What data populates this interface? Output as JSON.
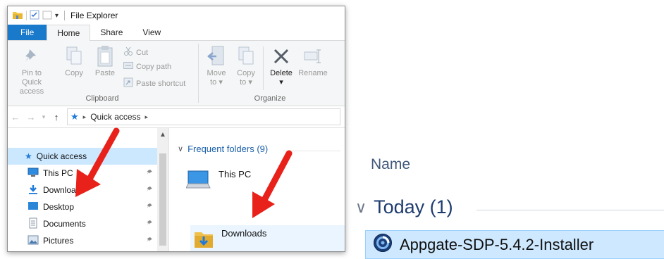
{
  "window": {
    "title": "File Explorer",
    "tabs": [
      {
        "label": "File"
      },
      {
        "label": "Home"
      },
      {
        "label": "Share"
      },
      {
        "label": "View"
      }
    ]
  },
  "ribbon": {
    "clipboard": {
      "pin_line1": "Pin to Quick",
      "pin_line2": "access",
      "copy": "Copy",
      "paste": "Paste",
      "cut": "Cut",
      "copy_path": "Copy path",
      "paste_shortcut": "Paste shortcut",
      "group_label": "Clipboard"
    },
    "organize": {
      "move_to": "Move",
      "move_to_2": "to",
      "copy_to": "Copy",
      "copy_to_2": "to",
      "delete": "Delete",
      "rename": "Rename",
      "group_label": "Organize"
    }
  },
  "address": {
    "path": "Quick access"
  },
  "nav": {
    "items": [
      {
        "label": "Quick access"
      },
      {
        "label": "This PC"
      },
      {
        "label": "Downloads"
      },
      {
        "label": "Desktop"
      },
      {
        "label": "Documents"
      },
      {
        "label": "Pictures"
      }
    ]
  },
  "main": {
    "frequent_label": "Frequent folders (9)",
    "tiles": [
      {
        "label": "This PC"
      },
      {
        "label": "Downloads"
      }
    ]
  },
  "detail": {
    "column_header": "Name",
    "group_label": "Today (1)",
    "file_name": "Appgate-SDP-5.4.2-Installer"
  },
  "colors": {
    "accent": "#1979ca",
    "arrow": "#e8221b",
    "selection": "#cce8ff"
  }
}
